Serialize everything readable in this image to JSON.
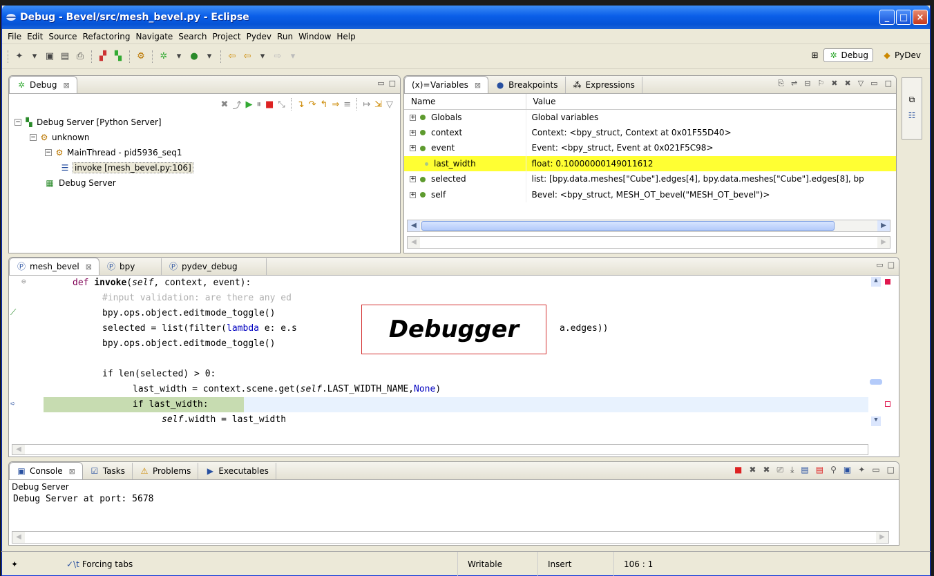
{
  "window": {
    "title": "Debug - Bevel/src/mesh_bevel.py - Eclipse"
  },
  "menu": [
    "File",
    "Edit",
    "Source",
    "Refactoring",
    "Navigate",
    "Search",
    "Project",
    "Pydev",
    "Run",
    "Window",
    "Help"
  ],
  "perspectives": {
    "debug": "Debug",
    "pydev": "PyDev"
  },
  "debug_view": {
    "tab": "Debug",
    "tree": {
      "server": "Debug Server [Python Server]",
      "unknown": "unknown",
      "thread": "MainThread - pid5936_seq1",
      "frame": "invoke [mesh_bevel.py:106]",
      "server2": "Debug Server"
    }
  },
  "variables_view": {
    "tabs": [
      "Variables",
      "Breakpoints",
      "Expressions"
    ],
    "columns": [
      "Name",
      "Value"
    ],
    "rows": [
      {
        "name": "Globals",
        "value": "Global variables"
      },
      {
        "name": "context",
        "value": "Context: <bpy_struct, Context at 0x01F55D40>"
      },
      {
        "name": "event",
        "value": "Event: <bpy_struct, Event at 0x021F5C98>"
      },
      {
        "name": "last_width",
        "value": "float: 0.10000000149011612"
      },
      {
        "name": "selected",
        "value": "list: [bpy.data.meshes[\"Cube\"].edges[4], bpy.data.meshes[\"Cube\"].edges[8], bp"
      },
      {
        "name": "self",
        "value": "Bevel: <bpy_struct, MESH_OT_bevel(\"MESH_OT_bevel\")>"
      }
    ]
  },
  "editor": {
    "tabs": [
      "mesh_bevel",
      "bpy",
      "pydev_debug"
    ],
    "code": {
      "l1_def": "def",
      "l1_name": "invoke",
      "l1_open": "(",
      "l1_self": "self",
      "l1_rest": ", context, event):",
      "l2": "#input validation: are there any ed",
      "l2b": "ed?",
      "l3": "bpy.ops.object.editmode_toggle()",
      "l4a": "selected = list(filter(",
      "l4kw": "lambda",
      "l4b": " e: e.s",
      "l4c": "a.edges))",
      "l5": "bpy.ops.object.editmode_toggle()",
      "l7": "if len(selected) > 0:",
      "l8a": "last_width = context.scene.get(",
      "l8self": "self",
      "l8b": ".LAST_WIDTH_NAME,",
      "l8none": "None",
      "l8c": ")",
      "l9": "if last_width:",
      "l10self": "self",
      "l10b": ".width = last_width"
    }
  },
  "callout": {
    "text": "Debugger"
  },
  "console": {
    "tabs": [
      "Console",
      "Tasks",
      "Problems",
      "Executables"
    ],
    "label": "Debug Server",
    "output": "Debug Server at port: 5678"
  },
  "status": {
    "message": "Forcing tabs",
    "mode": "Writable",
    "insert": "Insert",
    "position": "106 : 1"
  },
  "colors": {
    "title_bar": "#0a5ee8",
    "highlight_row": "#ffff33",
    "current_line": "#c7dcb1",
    "keyword": "#7f0055"
  }
}
